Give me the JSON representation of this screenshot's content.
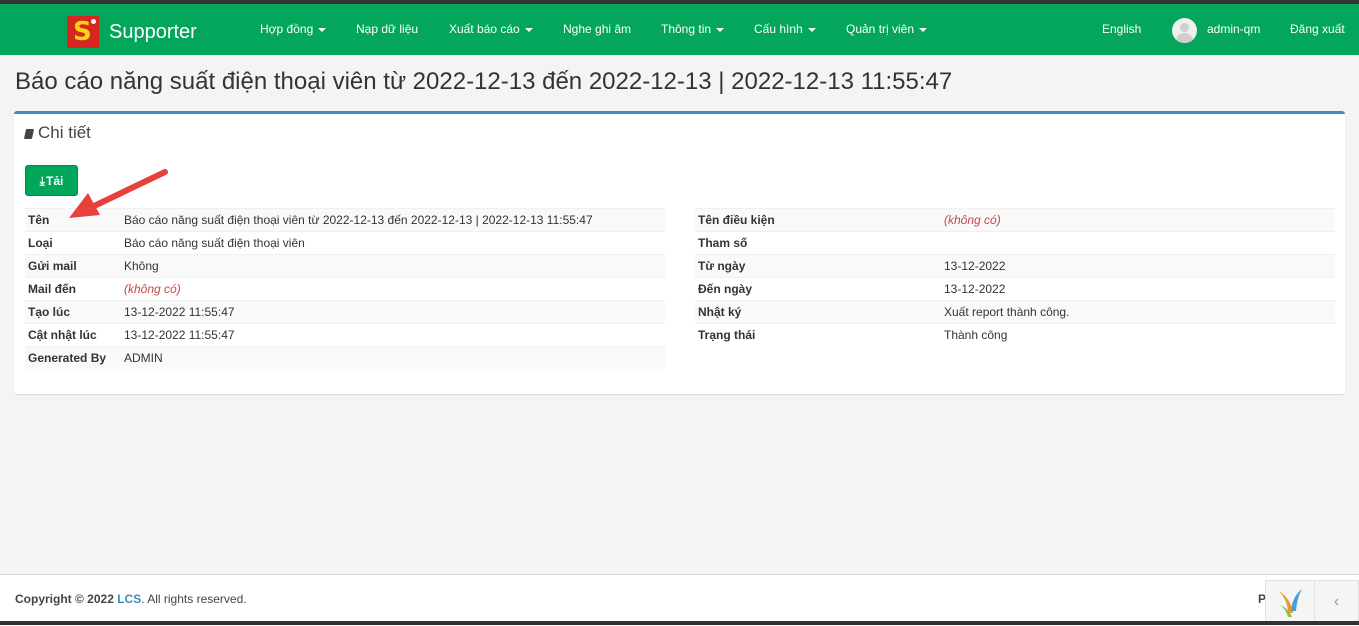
{
  "brand": {
    "name": "Supporter",
    "logo_letter": "S"
  },
  "nav": {
    "items": [
      {
        "label": "Hợp đồng",
        "dropdown": true
      },
      {
        "label": "Nạp dữ liệu",
        "dropdown": false
      },
      {
        "label": "Xuất báo cáo",
        "dropdown": true
      },
      {
        "label": "Nghe ghi âm",
        "dropdown": false
      },
      {
        "label": "Thông tin",
        "dropdown": true
      },
      {
        "label": "Cấu hình",
        "dropdown": true
      },
      {
        "label": "Quản trị viên",
        "dropdown": true
      }
    ],
    "language": "English",
    "user": "admin-qm",
    "logout": "Đăng xuất"
  },
  "page": {
    "title": "Báo cáo năng suất điện thoại viên từ 2022-12-13 đến 2022-12-13 | 2022-12-13 11:55:47"
  },
  "panel": {
    "title": "Chi tiết",
    "download_label": "Tải"
  },
  "details_left": [
    {
      "key": "Tên",
      "value": "Báo cáo năng suất điện thoại viên từ 2022-12-13 đến 2022-12-13 | 2022-12-13 11:55:47"
    },
    {
      "key": "Loại",
      "value": "Báo cáo năng suất điện thoại viên"
    },
    {
      "key": "Gửi mail",
      "value": "Không"
    },
    {
      "key": "Mail đến",
      "value": "(không có)"
    },
    {
      "key": "Tạo lúc",
      "value": "13-12-2022 11:55:47"
    },
    {
      "key": "Cật nhật lúc",
      "value": "13-12-2022 11:55:47"
    },
    {
      "key": "Generated By",
      "value": "ADMIN"
    }
  ],
  "details_right": [
    {
      "key": "Tên điều kiện",
      "value": "(không có)"
    },
    {
      "key": "Tham số",
      "value": ""
    },
    {
      "key": "Từ ngày",
      "value": "13-12-2022"
    },
    {
      "key": "Đến ngày",
      "value": "13-12-2022"
    },
    {
      "key": "Nhật ký",
      "value": "Xuất report thành công."
    },
    {
      "key": "Trạng thái",
      "value": "Thành công"
    }
  ],
  "footer": {
    "copyright_prefix": "Copyright © 2022",
    "company": "LCS",
    "suffix": ". All rights reserved.",
    "powered": "P"
  },
  "colors": {
    "navbar": "#03a65a",
    "panel_accent": "#3c8dbc",
    "button": "#00a65a",
    "empty_value": "#c04a4a",
    "annotation_arrow": "#e8403a"
  }
}
